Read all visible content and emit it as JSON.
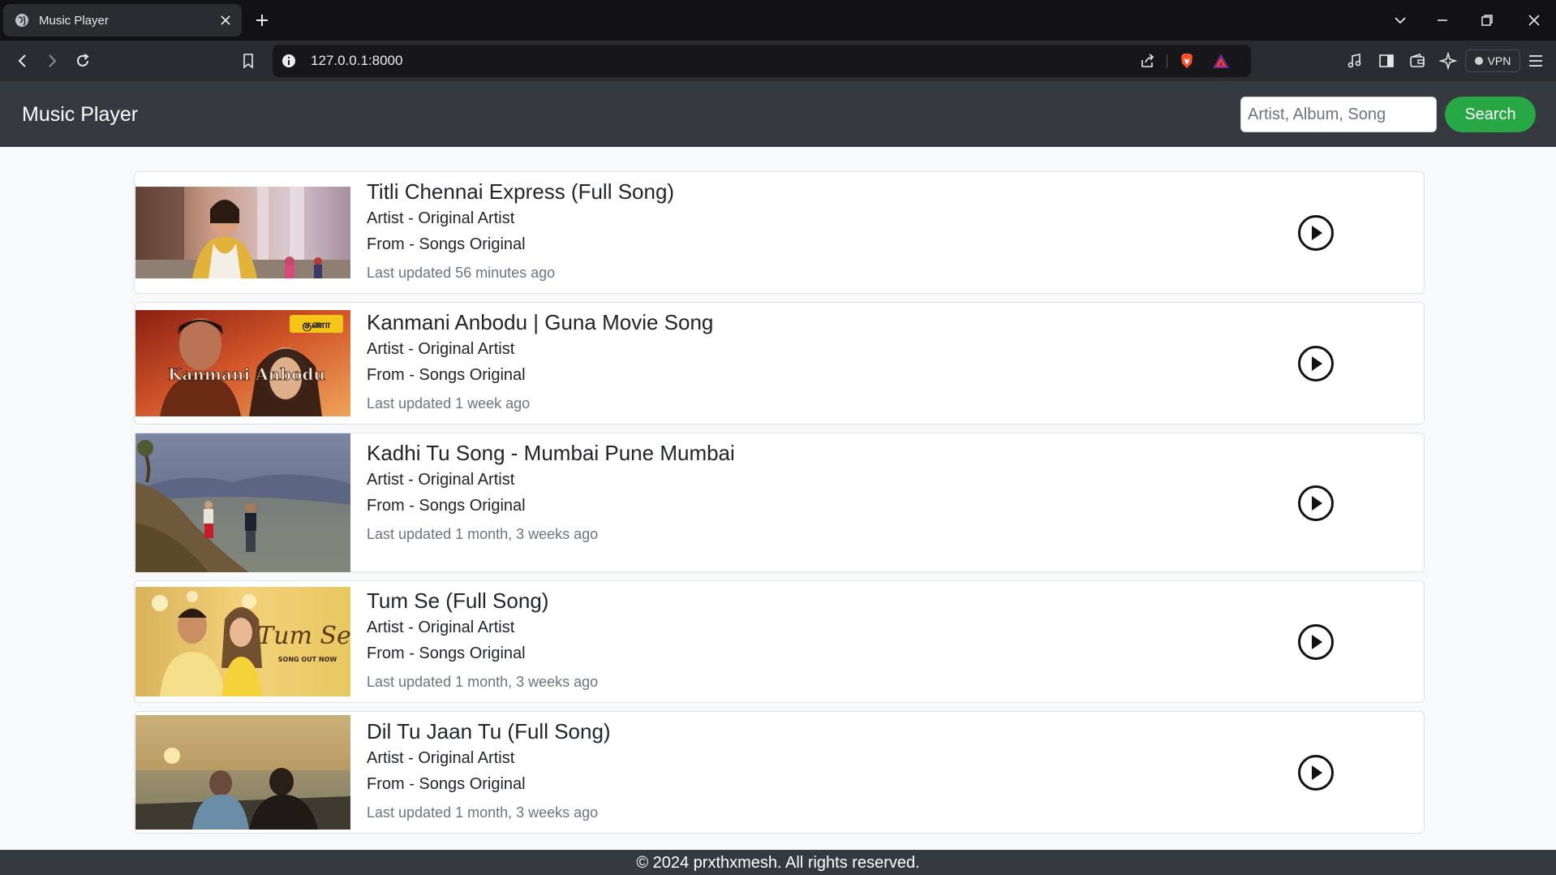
{
  "browser": {
    "tab_title": "Music Player",
    "url": "127.0.0.1:8000",
    "vpn_label": "VPN"
  },
  "navbar": {
    "brand": "Music Player",
    "search_placeholder": "Artist, Album, Song",
    "search_label": "Search"
  },
  "songs": [
    {
      "title": "Titli Chennai Express (Full Song)",
      "artist": "Artist - Original Artist",
      "album": "From - Songs Original",
      "updated": "Last updated 56 minutes ago"
    },
    {
      "title": "Kanmani Anbodu | Guna Movie Song",
      "artist": "Artist - Original Artist",
      "album": "From - Songs Original",
      "updated": "Last updated 1 week ago",
      "thumb_text": "Kanmani Anbodu"
    },
    {
      "title": "Kadhi Tu Song - Mumbai Pune Mumbai",
      "artist": "Artist - Original Artist",
      "album": "From - Songs Original",
      "updated": "Last updated 1 month, 3 weeks ago"
    },
    {
      "title": "Tum Se (Full Song)",
      "artist": "Artist - Original Artist",
      "album": "From - Songs Original",
      "updated": "Last updated 1 month, 3 weeks ago",
      "thumb_text": "Tum Se",
      "thumb_subtext": "SONG OUT NOW"
    },
    {
      "title": "Dil Tu Jaan Tu (Full Song)",
      "artist": "Artist - Original Artist",
      "album": "From - Songs Original",
      "updated": "Last updated 1 month, 3 weeks ago"
    }
  ],
  "footer": {
    "text": "© 2024 prxthxmesh. All rights reserved."
  },
  "colors": {
    "navbar": "#343a40",
    "search_button": "#28a745",
    "page_bg": "#f8f9fa"
  }
}
